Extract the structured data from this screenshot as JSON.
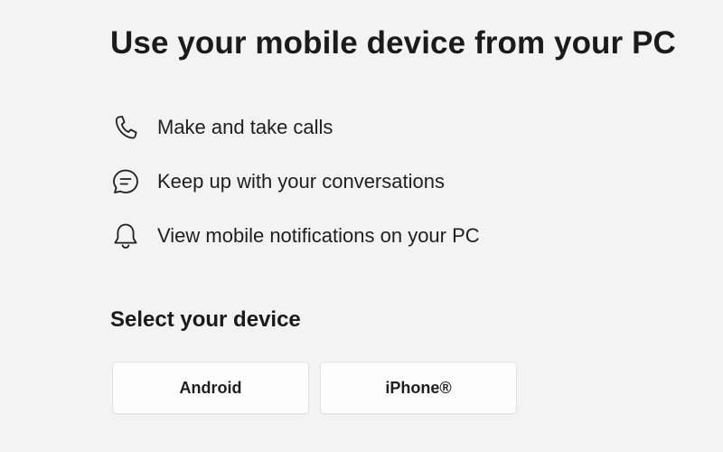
{
  "header": {
    "title": "Use your mobile device from your PC"
  },
  "features": [
    {
      "icon": "phone-icon",
      "label": "Make and take calls"
    },
    {
      "icon": "chat-bubble-icon",
      "label": "Keep up with your conversations"
    },
    {
      "icon": "bell-icon",
      "label": "View mobile notifications on your PC"
    }
  ],
  "device_select": {
    "title": "Select your device",
    "options": [
      {
        "label": "Android"
      },
      {
        "label": "iPhone®"
      }
    ]
  },
  "colors": {
    "background": "#f3f3f3",
    "button_bg": "#fdfdfd",
    "text": "#1b1b1b"
  }
}
